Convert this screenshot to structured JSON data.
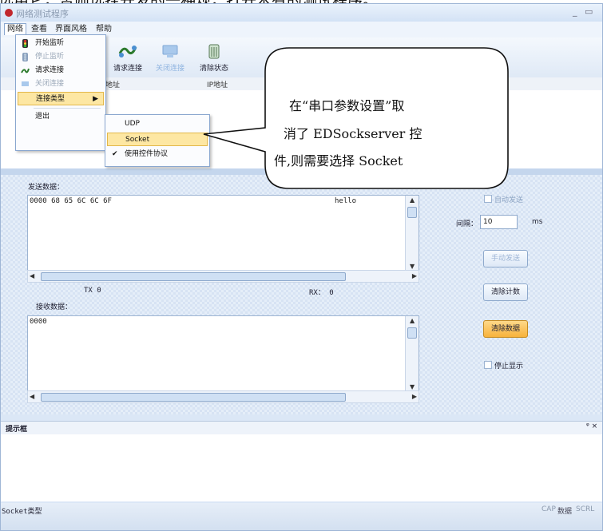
{
  "caption": "选用它，否则选择开发的一种规，打开木有的测试程序。",
  "window": {
    "title": "网络测试程序",
    "controls": [
      "_",
      "▭",
      "×"
    ]
  },
  "menubar": {
    "items": [
      "网络",
      "查看",
      "界面风格",
      "帮助"
    ]
  },
  "toolbar": {
    "buttons": [
      {
        "label": "请求连接",
        "icon": "connect-icon",
        "enabled": true
      },
      {
        "label": "关闭连接",
        "icon": "disconnect-icon",
        "enabled": false
      },
      {
        "label": "清除状态",
        "icon": "clear-status-icon",
        "enabled": true
      }
    ]
  },
  "grid": {
    "columns": [
      "地址",
      "IP地址"
    ]
  },
  "network_menu": {
    "items": [
      {
        "label": "开始监听",
        "icon": "traffic-light-icon",
        "enabled": true
      },
      {
        "label": "停止监听",
        "icon": "traffic-light-stop-icon",
        "enabled": false
      },
      {
        "label": "请求连接",
        "icon": "connect-icon",
        "enabled": true
      },
      {
        "label": "关闭连接",
        "icon": "disconnect-icon",
        "enabled": false
      },
      {
        "label": "连接类型",
        "submenu_arrow": "▶",
        "enabled": true
      },
      {
        "label": "退出",
        "enabled": true
      }
    ]
  },
  "submenu": {
    "items": [
      {
        "label": "UDP",
        "checked": false
      },
      {
        "label": "Socket",
        "checked": false,
        "highlighted": true
      },
      {
        "label": "使用控件协议",
        "checked": true,
        "check_mark": "✔"
      }
    ]
  },
  "callout": {
    "lines": [
      "在“串口参数设置”取",
      "消了 EDSockserver 控",
      "件,则需要选择 Socket"
    ]
  },
  "send": {
    "label": "发送数据：",
    "hex": "0000 68 65 6C 6C 6F",
    "text": "hello",
    "tx_label": "TX  0",
    "rx_label": "RX： 0"
  },
  "auto_send": {
    "label": "自动发送",
    "enabled": false
  },
  "interval": {
    "label": "间隔：",
    "value": "10",
    "unit": "ms"
  },
  "manual_send": {
    "label": "手动发送",
    "enabled": false
  },
  "clear_count": {
    "label": "清除计数"
  },
  "receive": {
    "label": "接收数据：",
    "hex": "0000"
  },
  "clear_data": {
    "label": "清除数据"
  },
  "stop_display": {
    "label": "停止显示"
  },
  "hint": {
    "title": "提示框",
    "controls": "ᵠ ×"
  },
  "status": {
    "text": "Socket类型",
    "indicators": [
      "CAP",
      "数据",
      "SCRL"
    ]
  },
  "colors": {
    "accent": "#f7b23b",
    "highlight": "#fde7a3",
    "frame": "#dbe7f6"
  }
}
